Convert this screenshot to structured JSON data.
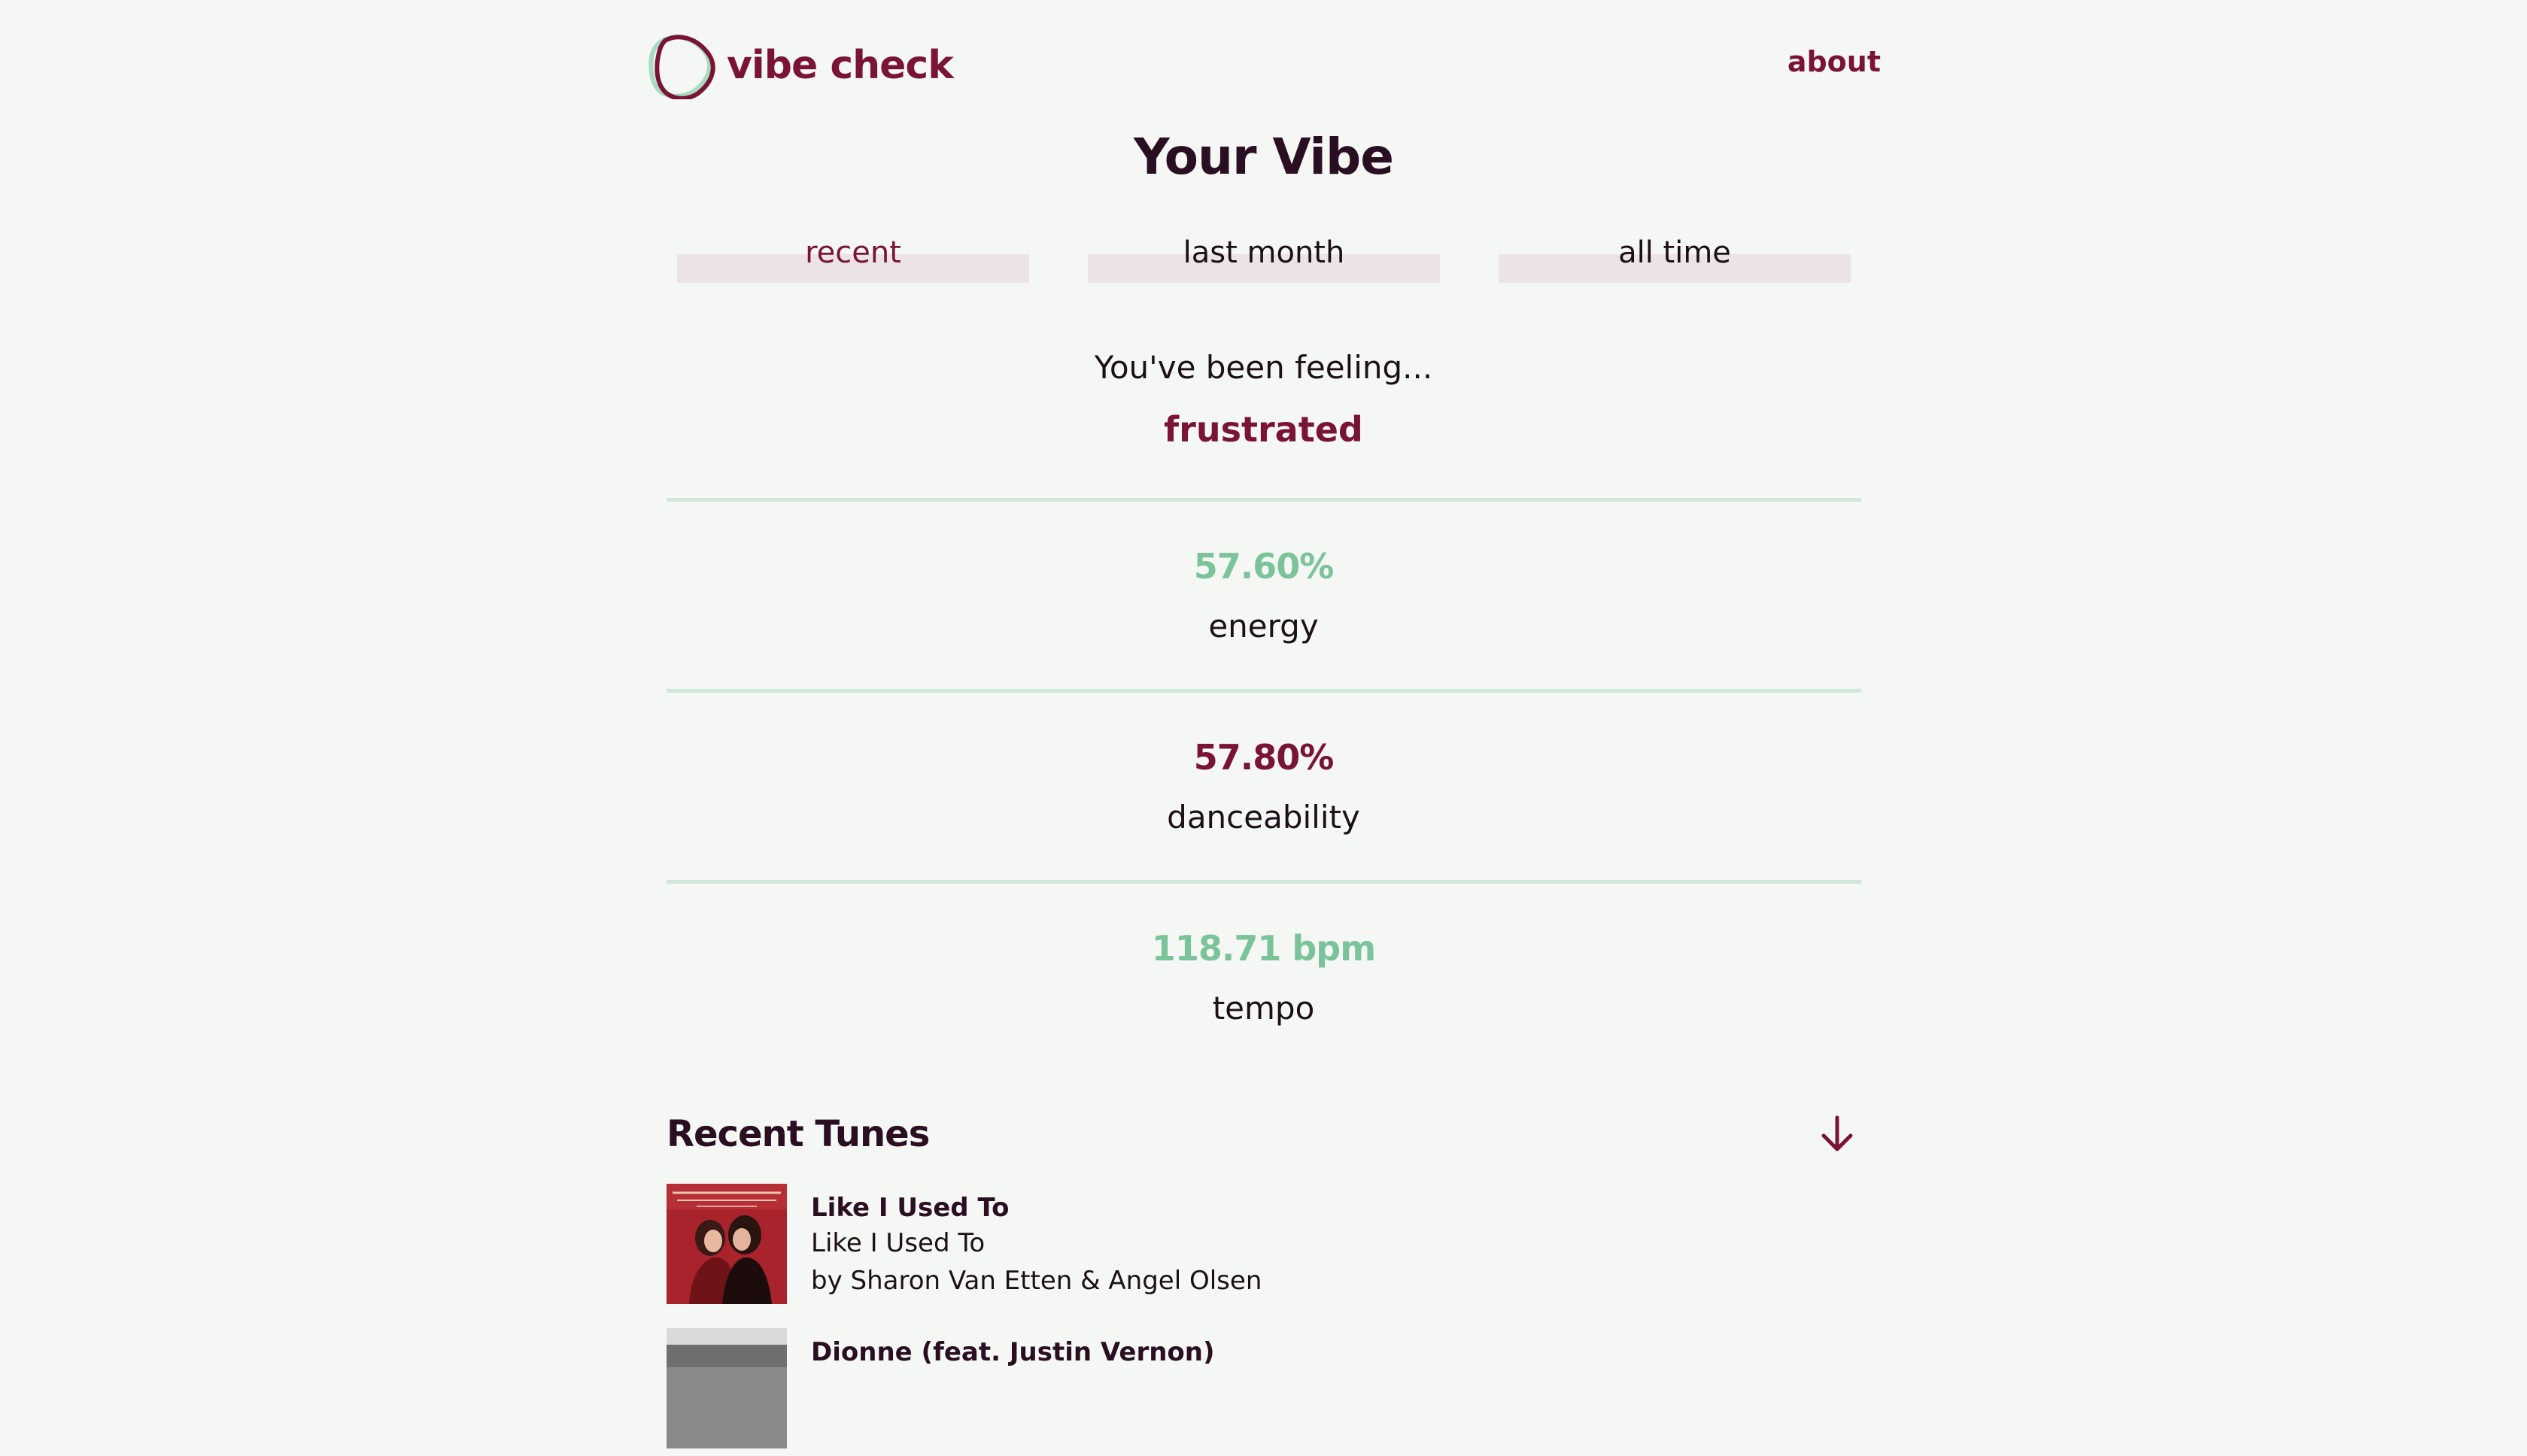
{
  "brand": {
    "name": "vibe check",
    "accent_color": "#7a1437",
    "secondary_color": "#7bc49a"
  },
  "nav": {
    "about_label": "about"
  },
  "page_title": "Your Vibe",
  "tabs": [
    {
      "label": "recent",
      "active": true
    },
    {
      "label": "last month",
      "active": false
    },
    {
      "label": "all time",
      "active": false
    }
  ],
  "feeling": {
    "intro": "You've been feeling...",
    "value": "frustrated"
  },
  "stats": {
    "energy": {
      "value": "57.60%",
      "label": "energy"
    },
    "danceability": {
      "value": "57.80%",
      "label": "danceability"
    },
    "tempo": {
      "value": "118.71 bpm",
      "label": "tempo"
    }
  },
  "recent_tunes": {
    "title": "Recent Tunes",
    "sort_icon": "arrow-down-icon",
    "tracks": [
      {
        "title": "Like I Used To",
        "album": "Like I Used To",
        "artist": "by Sharon Van Etten & Angel Olsen"
      },
      {
        "title": "Dionne (feat. Justin Vernon)",
        "album": "",
        "artist": ""
      }
    ]
  }
}
